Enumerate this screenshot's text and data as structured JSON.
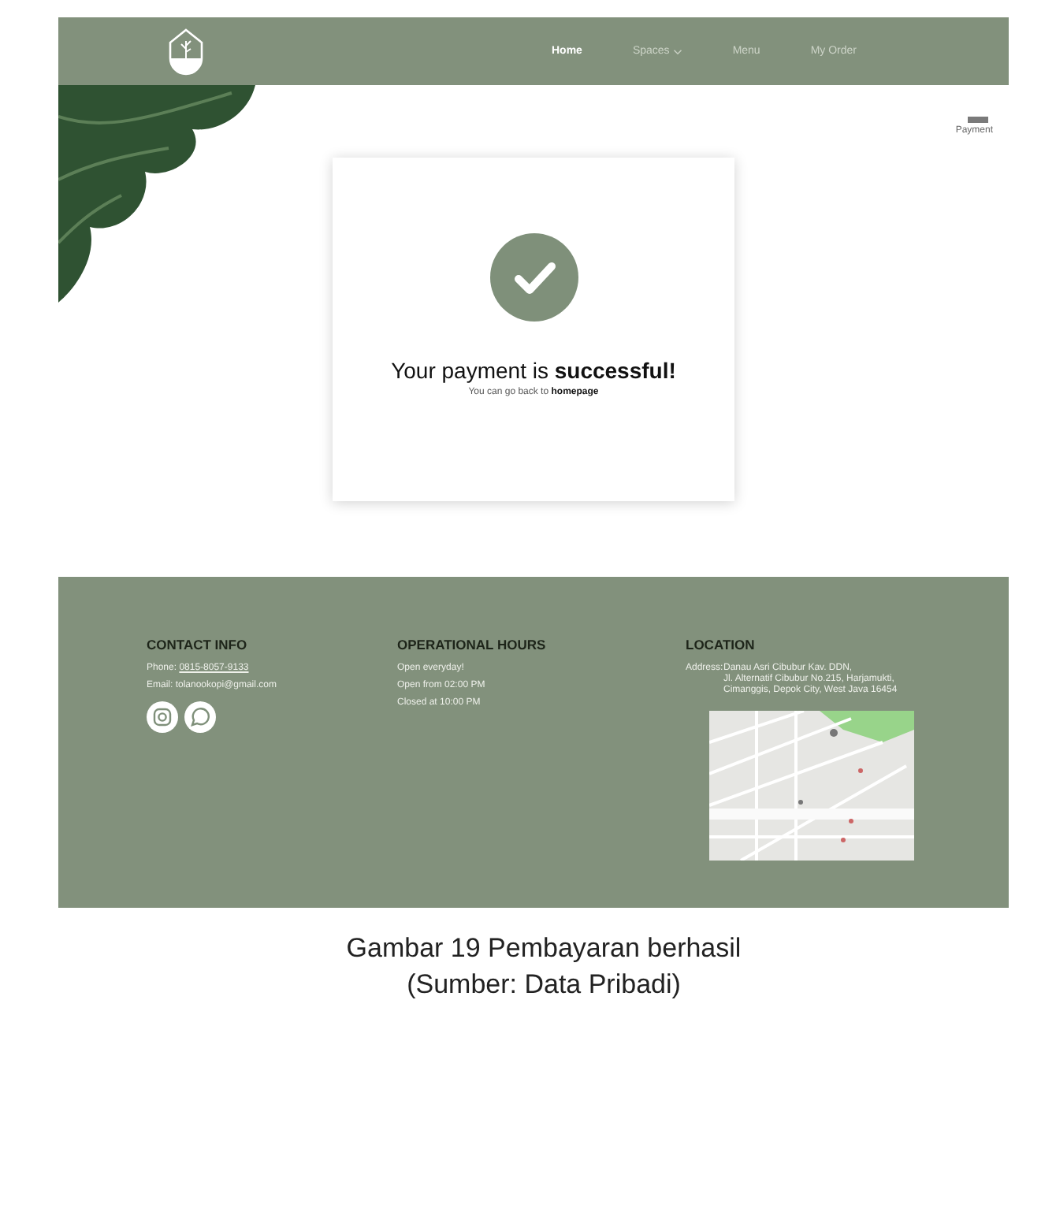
{
  "nav": {
    "links": [
      {
        "label": "Home",
        "selected": true,
        "dropdown": false
      },
      {
        "label": "Spaces",
        "selected": false,
        "dropdown": true
      },
      {
        "label": "Menu",
        "selected": false,
        "dropdown": false
      },
      {
        "label": "My Order",
        "selected": false,
        "dropdown": false
      }
    ]
  },
  "step": {
    "label": "Payment"
  },
  "success": {
    "title": "Your payment is **successful!**",
    "text": "You can go back to",
    "link": "homepage"
  },
  "footer": {
    "contact": {
      "heading": "CONTACT INFO",
      "phone_label": "Phone:",
      "phone": "0815-8057-9133",
      "email": "Email: tolanookopi@gmail.com"
    },
    "hours": {
      "heading": "OPERATIONAL HOURS",
      "lines": [
        "Open everyday!",
        "Open from 02:00 PM",
        "Closed at 10:00 PM"
      ]
    },
    "location": {
      "heading": "LOCATION",
      "address_label": "Address:",
      "address": [
        "Danau Asri Cibubur Kav. DDN,",
        "Jl. Alternatif Cibubur No.215, Harjamukti,",
        "Cimanggis, Depok City, West Java 16454"
      ]
    }
  },
  "caption": [
    "Gambar 19 Pembayaran berhasil",
    "(Sumber: Data Pribadi)"
  ]
}
